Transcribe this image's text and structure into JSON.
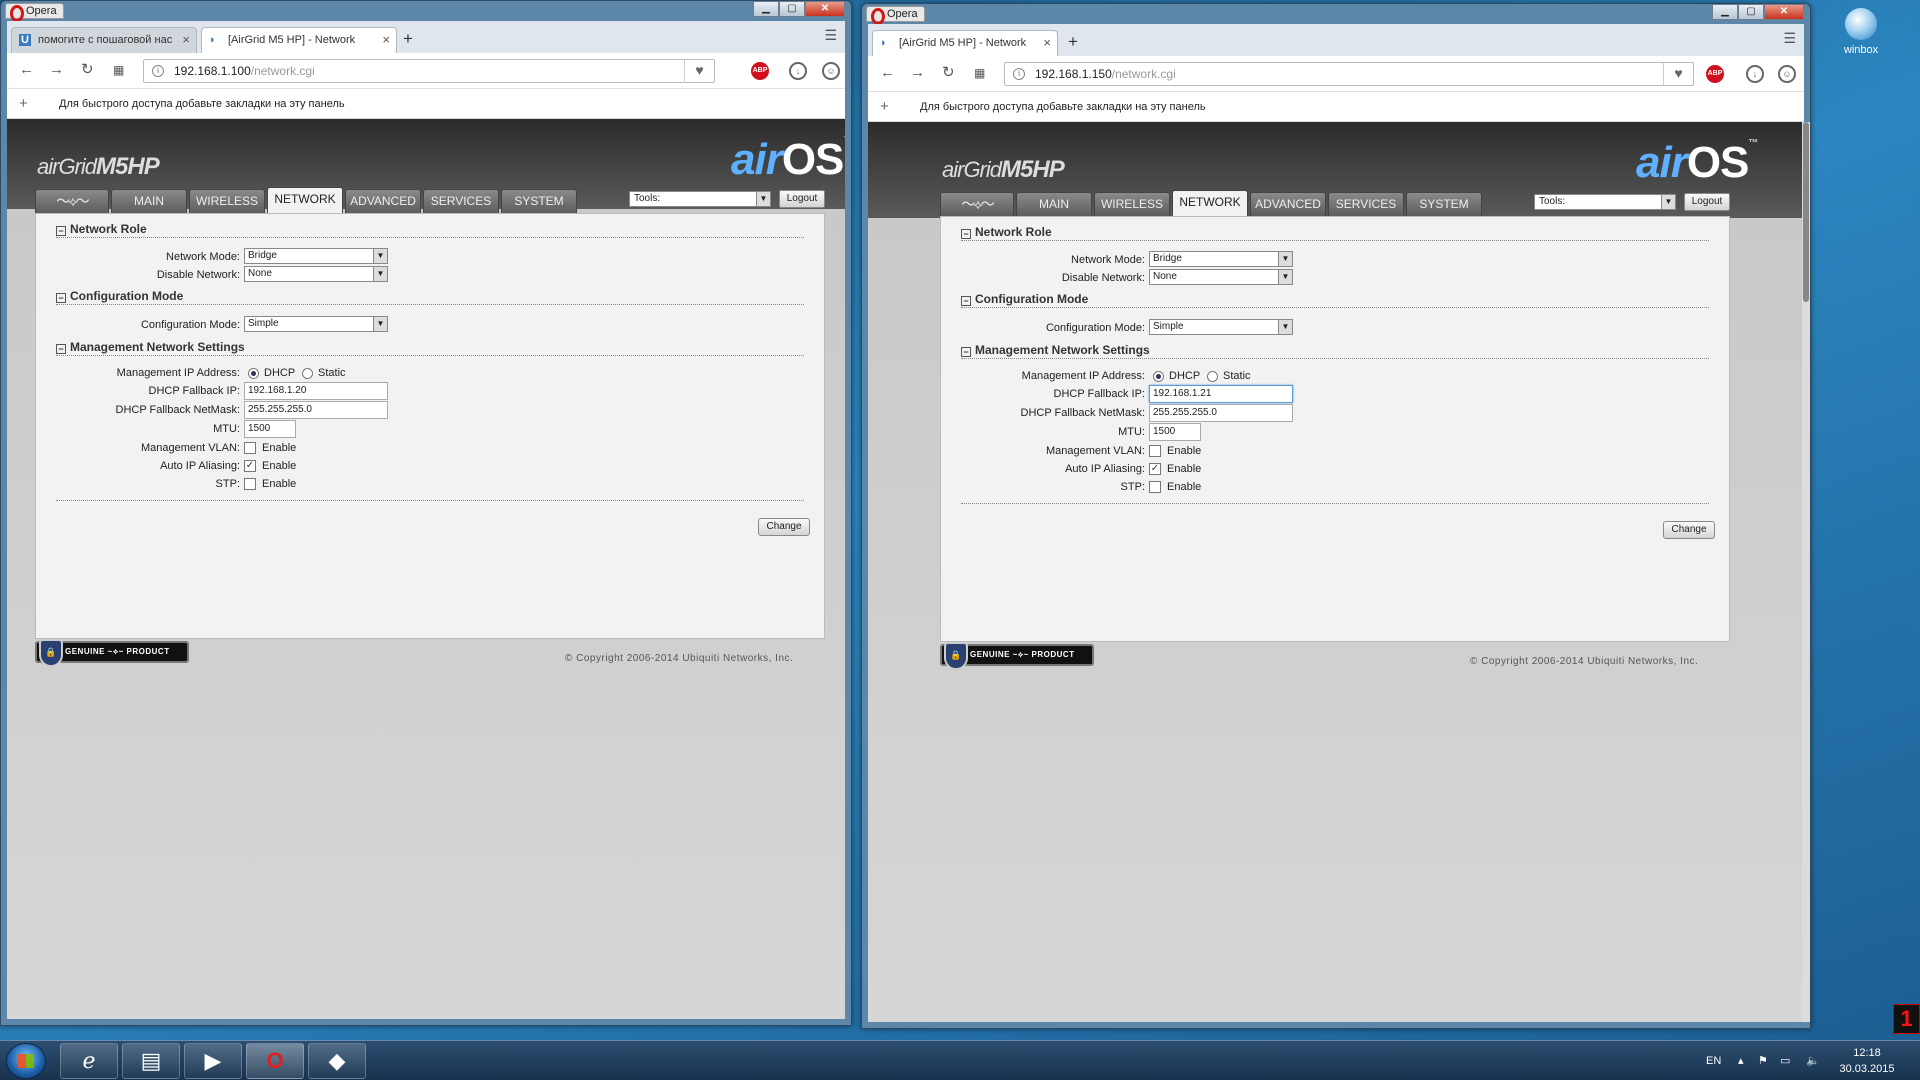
{
  "desktop": {
    "icon_label": "winbox",
    "badge": "1"
  },
  "browser": {
    "app_label": "Opera",
    "bookmarks_hint": "Для быстрого доступа добавьте закладки на эту панель",
    "abp": "ABP"
  },
  "window1": {
    "tabs": [
      {
        "label": "помогите с пошаговой нас",
        "icon": "U"
      },
      {
        "label": "[AirGrid M5 HP] - Network",
        "icon": "wifi"
      }
    ],
    "url_host": "192.168.1.100",
    "url_path": "/network.cgi",
    "dhcp_fallback_ip": "192.168.1.20"
  },
  "window2": {
    "tabs": [
      {
        "label": "[AirGrid M5 HP] - Network",
        "icon": "wifi"
      }
    ],
    "url_host": "192.168.1.150",
    "url_path": "/network.cgi",
    "dhcp_fallback_ip": "192.168.1.21"
  },
  "airos": {
    "brand_prefix": "airGrid",
    "brand_model": "M5HP",
    "logo_air": "air",
    "logo_os": "OS",
    "logo_tm": "™",
    "nav_tabs": [
      "MAIN",
      "WIRELESS",
      "NETWORK",
      "ADVANCED",
      "SERVICES",
      "SYSTEM"
    ],
    "active_tab": "NETWORK",
    "tools_label": "Tools:",
    "logout_label": "Logout",
    "sections": {
      "network_role": "Network Role",
      "configuration_mode": "Configuration Mode",
      "management_network": "Management Network Settings"
    },
    "labels": {
      "network_mode": "Network Mode:",
      "disable_network": "Disable Network:",
      "configuration_mode": "Configuration Mode:",
      "management_ip": "Management IP Address:",
      "dhcp_fallback_ip": "DHCP Fallback IP:",
      "dhcp_fallback_netmask": "DHCP Fallback NetMask:",
      "mtu": "MTU:",
      "management_vlan": "Management VLAN:",
      "auto_ip_aliasing": "Auto IP Aliasing:",
      "stp": "STP:"
    },
    "values": {
      "network_mode": "Bridge",
      "disable_network": "None",
      "configuration_mode": "Simple",
      "dhcp_option": "DHCP",
      "static_option": "Static",
      "dhcp_fallback_netmask": "255.255.255.0",
      "mtu": "1500",
      "enable": "Enable"
    },
    "change_label": "Change",
    "genuine": "GENUINE",
    "product": "PRODUCT",
    "copyright": "© Copyright 2006-2014 Ubiquiti Networks, Inc."
  },
  "taskbar": {
    "lang": "EN",
    "time": "12:18",
    "date": "30.03.2015"
  }
}
